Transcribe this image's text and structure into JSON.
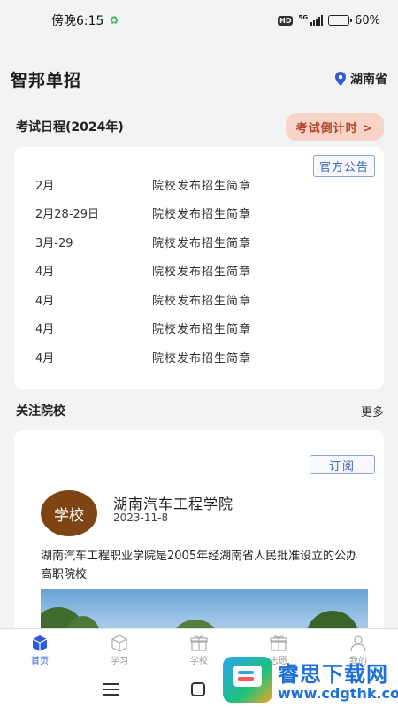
{
  "status_bar": {
    "time": "傍晚6:15",
    "hd": "HD",
    "network": "5G",
    "battery": "60%",
    "battery_level": 0.6
  },
  "header": {
    "title": "智邦单招",
    "location": "湖南省"
  },
  "schedule": {
    "title": "考试日程(2024年)",
    "countdown_label": "考试倒计时 >",
    "notice_label": "官方公告",
    "rows": [
      {
        "date": "2月",
        "event": "院校发布招生简章"
      },
      {
        "date": "2月28-29日",
        "event": "院校发布招生简章"
      },
      {
        "date": "3月-29",
        "event": "院校发布招生简章"
      },
      {
        "date": "4月",
        "event": "院校发布招生简章"
      },
      {
        "date": "4月",
        "event": "院校发布招生简章"
      },
      {
        "date": "4月",
        "event": "院校发布招生简章"
      },
      {
        "date": "4月",
        "event": "院校发布招生简章"
      }
    ]
  },
  "schools": {
    "title": "关注院校",
    "more_label": "更多",
    "card": {
      "subscribe_label": "订阅",
      "avatar_label": "学校",
      "name": "湖南汽车工程学院",
      "date": "2023-11-8",
      "description": "湖南汽车工程职业学院是2005年经湖南省人民批准设立的公办高职院校"
    }
  },
  "bottom_nav": {
    "items": [
      {
        "label": "首页",
        "icon": "home-box-icon"
      },
      {
        "label": "学习",
        "icon": "study-box-icon"
      },
      {
        "label": "学校",
        "icon": "school-gift-icon"
      },
      {
        "label": "志愿",
        "icon": "volunteer-gift-icon"
      },
      {
        "label": "我的",
        "icon": "profile-icon"
      }
    ]
  },
  "watermark": {
    "title": "睿思下载网",
    "url": "www.cdgthk.com"
  },
  "colors": {
    "accent": "#2d5bd8",
    "countdown_bg": "#f8d3c8",
    "countdown_text": "#b3442a",
    "avatar_bg": "#7e4414"
  }
}
